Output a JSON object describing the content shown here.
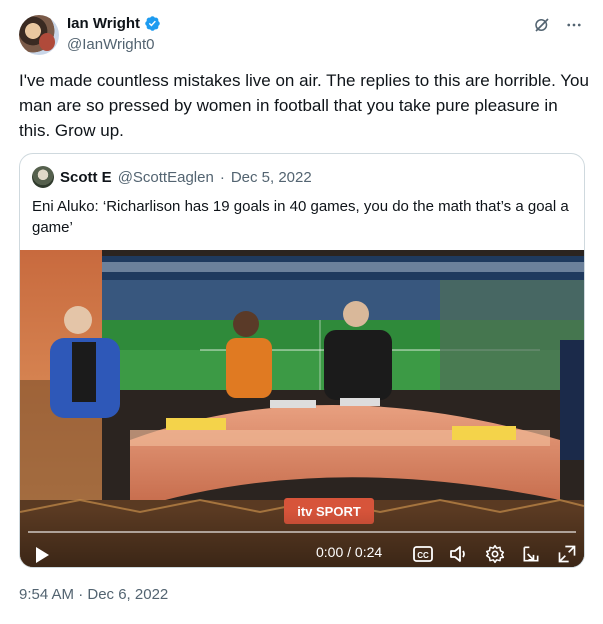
{
  "author": {
    "name": "Ian Wright",
    "handle": "@IanWright0"
  },
  "tweet": {
    "text": "I've made countless mistakes live on air. The replies to this are horrible. You man are so pressed by women in football that you take pure pleasure in this. Grow up.",
    "timestamp": "9:54 AM · Dec 6, 2022"
  },
  "quoted": {
    "name": "Scott E",
    "handle": "@ScottEaglen",
    "separator": "·",
    "date": "Dec 5, 2022",
    "text": "Eni Aluko: ‘Richarlison has 19 goals in 40 games, you do the math that’s a goal a game’"
  },
  "video": {
    "broadcaster_logo": "itv SPORT",
    "time": "0:00 / 0:24",
    "progress": 0.0,
    "controls": [
      "play-icon",
      "captions-icon",
      "volume-icon",
      "settings-icon",
      "popout-icon",
      "fullscreen-icon"
    ]
  },
  "icons": [
    "verified-icon",
    "grok-icon",
    "more-icon"
  ],
  "colors": {
    "verified": "#1d9bf0",
    "text": "#0f1419",
    "muted": "#536471",
    "border": "#cfd9de"
  }
}
